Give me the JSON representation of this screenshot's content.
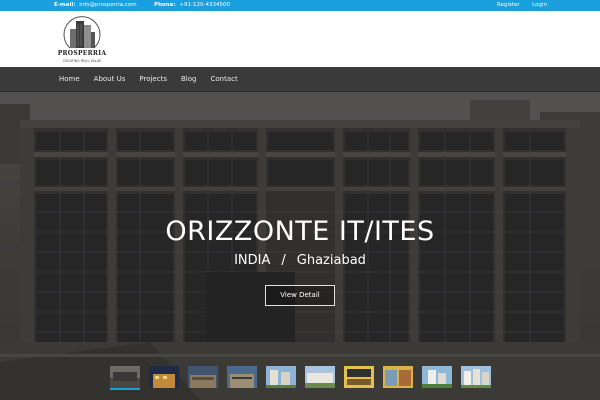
{
  "topbar": {
    "email_label": "E-mail:",
    "email_value": "info@prosperria.com",
    "phone_label": "Phone:",
    "phone_value": "+91-120-4334500",
    "register_label": "Register",
    "login_label": "Login"
  },
  "logo": {
    "name": "PROSPERRIA",
    "tagline": "CREATING REAL VALUE"
  },
  "nav": {
    "items": [
      "Home",
      "About Us",
      "Projects",
      "Blog",
      "Contact"
    ]
  },
  "hero": {
    "title": "ORIZZONTE IT/ITES",
    "country": "INDIA",
    "separator": "/",
    "city": "Ghaziabad",
    "button_label": "View Detail"
  },
  "thumbnails": {
    "count": 10,
    "active_index": 0
  },
  "colors": {
    "accent": "#1aa0de",
    "nav_bg": "#3a3a3a"
  }
}
